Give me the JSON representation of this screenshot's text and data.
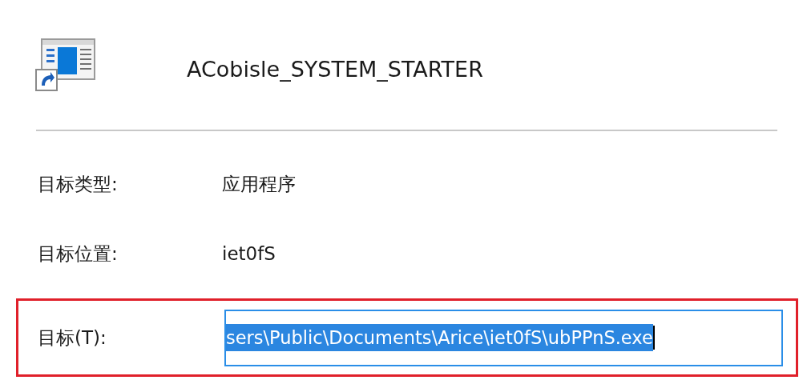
{
  "shortcut": {
    "name": "ACobisle_SYSTEM_STARTER"
  },
  "properties": [
    {
      "label": "目标类型:",
      "value": "应用程序"
    },
    {
      "label": "目标位置:",
      "value": "iet0fS"
    }
  ],
  "target": {
    "label": "目标(T):",
    "value": "sers\\Public\\Documents\\Arice\\iet0fS\\ubPPnS.exe",
    "selected": true,
    "highlighted": true
  }
}
